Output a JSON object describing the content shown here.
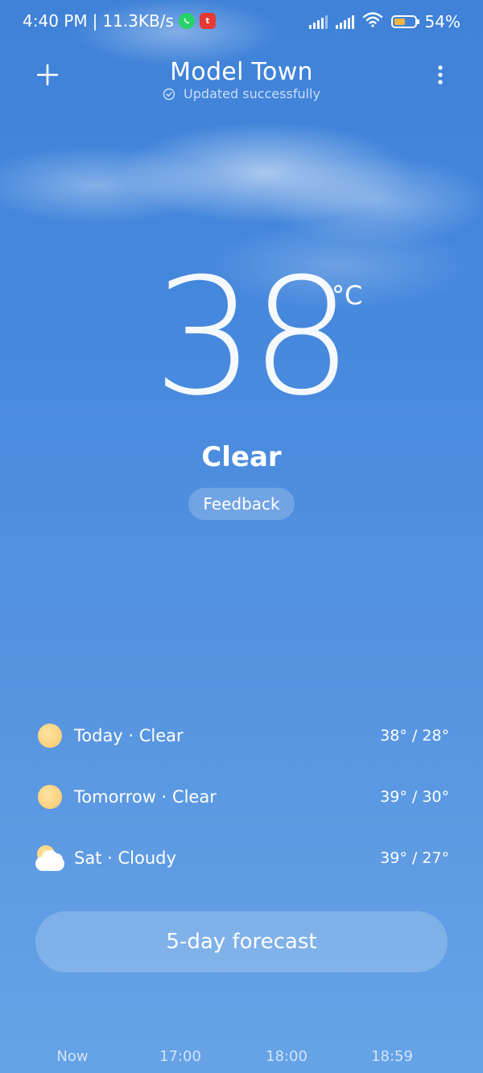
{
  "status_bar": {
    "time": "4:40 PM",
    "separator": "|",
    "speed": "11.3KB/s",
    "whatsapp_icon": "whatsapp-icon",
    "red_app_badge": "t",
    "battery_percent": "54%",
    "battery_level": 0.54,
    "battery_color": "#f5b342"
  },
  "header": {
    "location": "Model Town",
    "update_status": "Updated successfully"
  },
  "current": {
    "temperature": "38",
    "unit": "°C",
    "condition": "Clear",
    "feedback_label": "Feedback"
  },
  "forecast": [
    {
      "day": "Today",
      "condition": "Clear",
      "temps": "38° / 28°",
      "icon": "sun-icon"
    },
    {
      "day": "Tomorrow",
      "condition": "Clear",
      "temps": "39° / 30°",
      "icon": "sun-icon"
    },
    {
      "day": "Sat",
      "condition": "Cloudy",
      "temps": "39° / 27°",
      "icon": "cloudy-icon"
    }
  ],
  "five_day_label": "5-day forecast",
  "hourly": [
    "Now",
    "17:00",
    "18:00",
    "18:59"
  ],
  "colors": {
    "sky_top": "#3f82d8",
    "sky_bottom": "#66a3e6",
    "sun": "#f8c868"
  }
}
